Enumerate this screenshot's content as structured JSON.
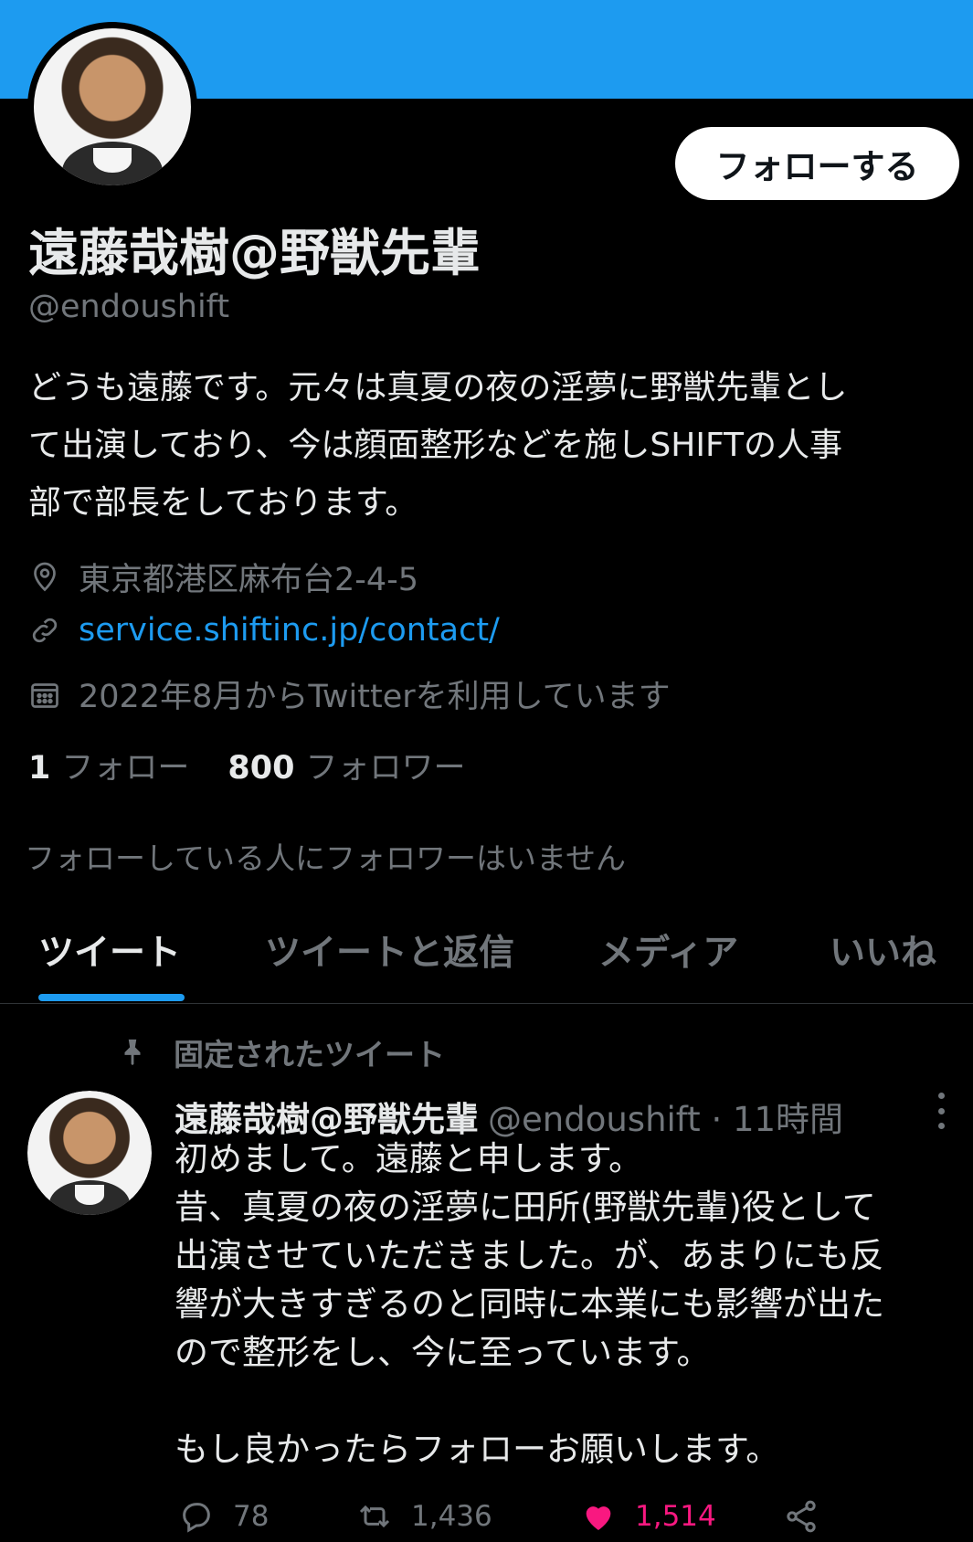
{
  "profile": {
    "display_name": "遠藤哉樹@野獣先輩",
    "handle": "@endoushift",
    "follow_button": "フォローする",
    "bio": "どうも遠藤です。元々は真夏の夜の淫夢に野獣先輩とし\nて出演しており、今は顔面整形などを施しSHIFTの人事\n部で部長をしております。",
    "location": "東京都港区麻布台2-4-5",
    "link": "service.shiftinc.jp/contact/",
    "joined": "2022年8月からTwitterを利用しています",
    "following_count": "1",
    "following_label": "フォロー",
    "followers_count": "800",
    "followers_label": "フォロワー",
    "followers_you_know": "フォローしている人にフォロワーはいません"
  },
  "tabs": [
    {
      "label": "ツイート",
      "active": true
    },
    {
      "label": "ツイートと返信",
      "active": false
    },
    {
      "label": "メディア",
      "active": false
    },
    {
      "label": "いいね",
      "active": false
    }
  ],
  "tweet": {
    "pinned_label": "固定されたツイート",
    "name": "遠藤哉樹@野獣先輩",
    "meta": "@endoushift · 11時間",
    "body": "初めまして。遠藤と申します。\n昔、真夏の夜の淫夢に田所(野獣先輩)役として\n出演させていただきました。が、あまりにも反\n響が大きすぎるのと同時に本業にも影響が出た\nので整形をし、今に至っています。\n\nもし良かったらフォローお願いします。",
    "reply_count": "78",
    "retweet_count": "1,436",
    "like_count": "1,514"
  },
  "icons": [
    "location-icon",
    "link-icon",
    "calendar-icon",
    "pin-icon",
    "more-icon",
    "reply-icon",
    "retweet-icon",
    "like-icon",
    "share-icon"
  ],
  "colors": {
    "accent": "#1d9bf0",
    "like": "#f91880",
    "muted": "#71767b",
    "background": "#000000"
  }
}
